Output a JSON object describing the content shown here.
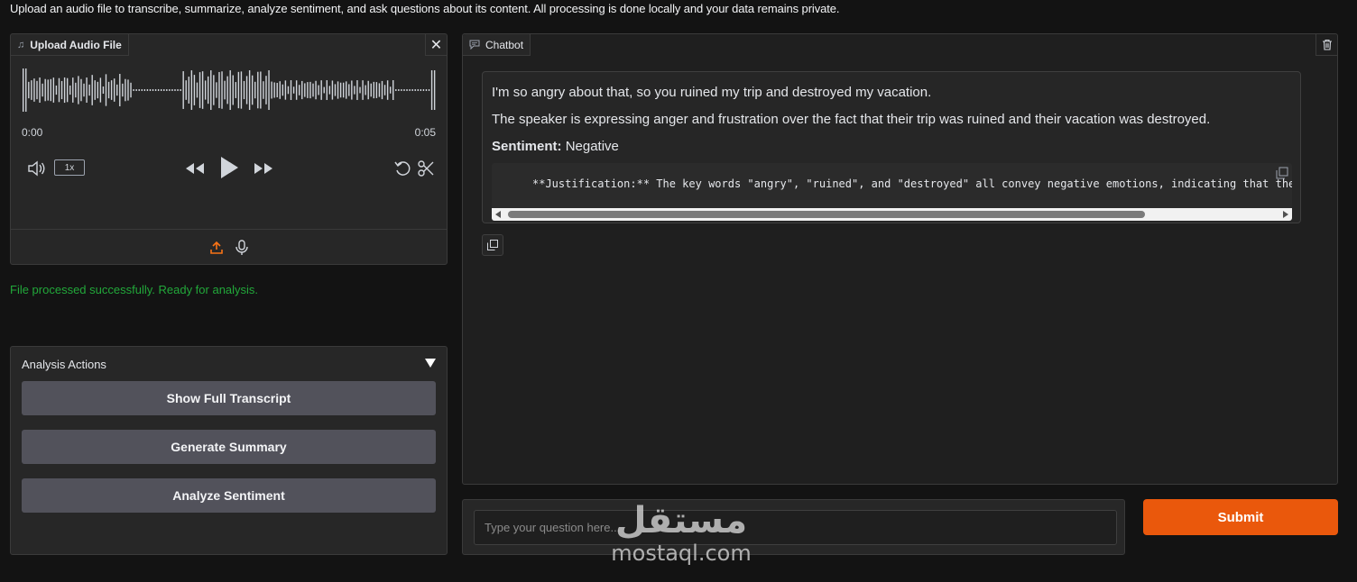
{
  "intro": "Upload an audio file to transcribe, summarize, analyze sentiment, and ask questions about its content. All processing is done locally and your data remains private.",
  "audio": {
    "label": "Upload Audio File",
    "label_icon": "music-note-icon",
    "close_icon": "close-icon",
    "time_start": "0:00",
    "time_end": "0:05",
    "speed": "1x",
    "icons": [
      "volume-icon",
      "rewind-icon",
      "play-icon",
      "fast-forward-icon",
      "undo-icon",
      "scissors-icon",
      "upload-icon",
      "microphone-icon"
    ],
    "upload_icon_color": "#f97316"
  },
  "status": {
    "text": "File processed successfully. Ready for analysis.",
    "color": "#22a83a"
  },
  "actions": {
    "title": "Analysis Actions",
    "buttons": [
      "Show Full Transcript",
      "Generate Summary",
      "Analyze Sentiment"
    ]
  },
  "chat": {
    "label": "Chatbot",
    "label_icon": "chat-icon",
    "trash_icon": "trash-icon",
    "message": {
      "line1": "I'm so angry about that, so you ruined my trip and destroyed my vacation.",
      "line2": "The speaker is expressing anger and frustration over the fact that their trip was ruined and their vacation was destroyed.",
      "sentiment_label": "Sentiment:",
      "sentiment_value": "Negative",
      "code": "**Justification:** The key words \"angry\", \"ruined\", and \"destroyed\" all convey negative emotions, indicating that the"
    }
  },
  "question": {
    "placeholder": "Type your question here..."
  },
  "submit": {
    "label": "Submit",
    "color": "#ea580c"
  },
  "watermark": {
    "arabic": "مستقل",
    "english": "mostaql.com"
  }
}
